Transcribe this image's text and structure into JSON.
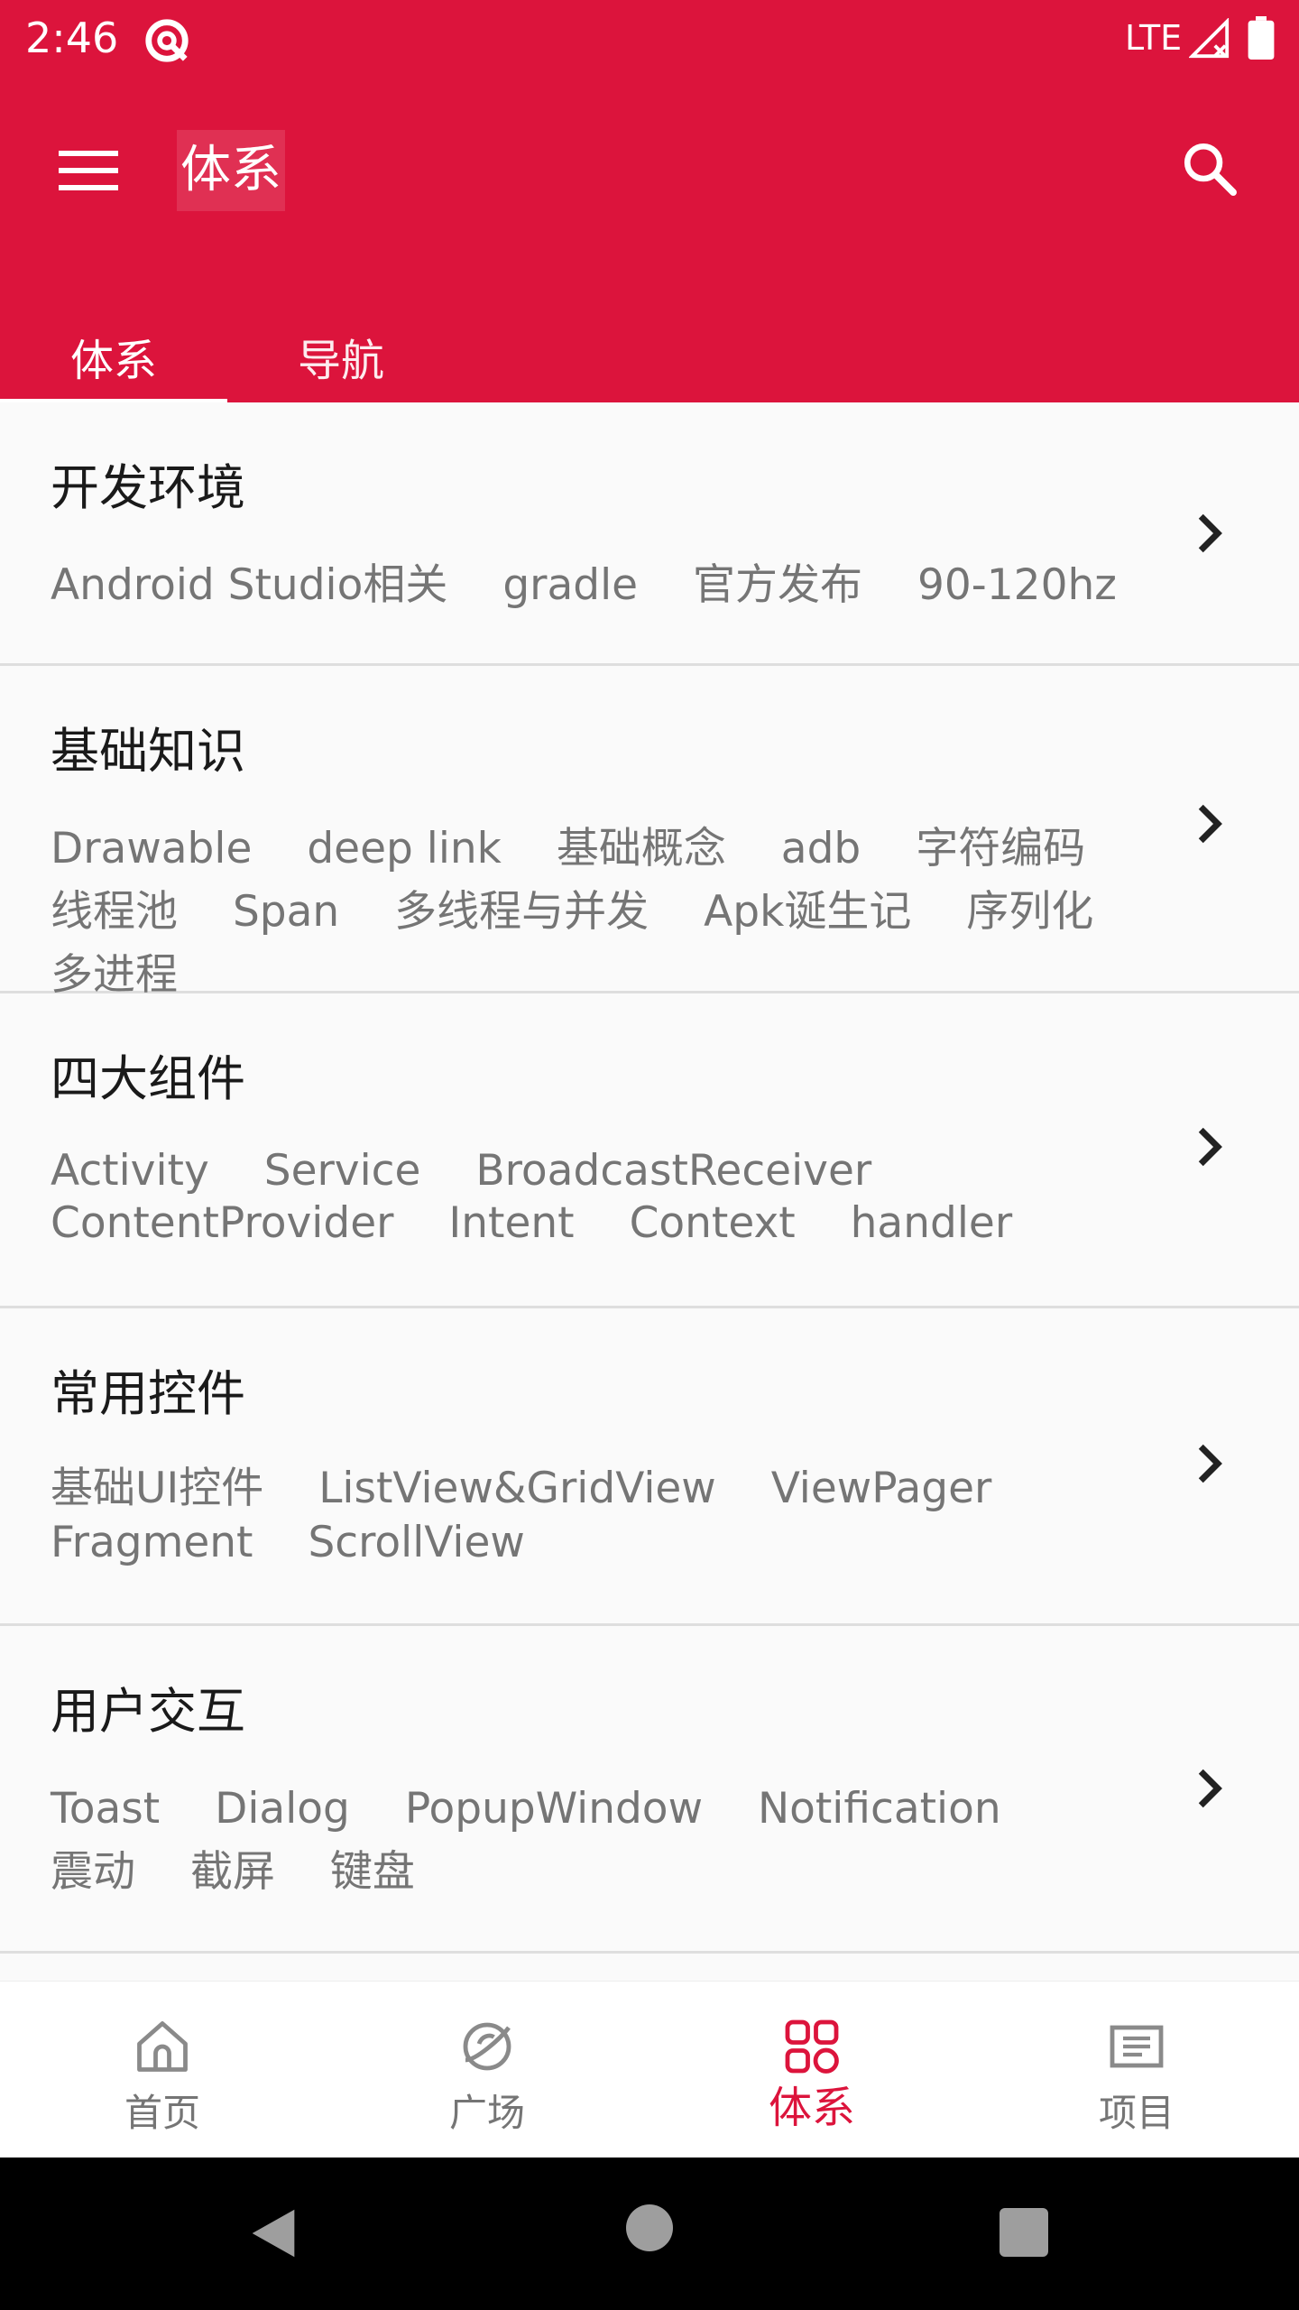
{
  "status_bar": {
    "time": "2:46",
    "network": "LTE",
    "icons": [
      "hotspot-icon",
      "signal-icon",
      "battery-icon"
    ]
  },
  "app_bar": {
    "title": "体系",
    "menu_icon": "menu-icon",
    "search_icon": "search-icon",
    "background_color": "#dc143c"
  },
  "tabs": [
    {
      "label": "体系",
      "selected": true
    },
    {
      "label": "导航",
      "selected": false
    }
  ],
  "categories": [
    {
      "title": "开发环境",
      "tags": [
        "Android Studio相关",
        "gradle",
        "官方发布",
        "90-120hz"
      ]
    },
    {
      "title": "基础知识",
      "tags": [
        "Drawable",
        "deep link",
        "基础概念",
        "adb",
        "字符编码",
        "线程池",
        "Span",
        "多线程与并发",
        "Apk诞生记",
        "序列化",
        "多进程"
      ]
    },
    {
      "title": "四大组件",
      "tags": [
        "Activity",
        "Service",
        "BroadcastReceiver",
        "ContentProvider",
        "Intent",
        "Context",
        "handler"
      ]
    },
    {
      "title": "常用控件",
      "tags": [
        "基础UI控件",
        "ListView&GridView",
        "ViewPager",
        "Fragment",
        "ScrollView"
      ]
    },
    {
      "title": "用户交互",
      "tags": [
        "Toast",
        "Dialog",
        "PopupWindow",
        "Notification",
        "震动",
        "截屏",
        "键盘"
      ]
    }
  ],
  "bottom_nav": [
    {
      "label": "首页",
      "icon": "home-icon",
      "active": false
    },
    {
      "label": "广场",
      "icon": "planet-icon",
      "active": false
    },
    {
      "label": "体系",
      "icon": "grid-icon",
      "active": true
    },
    {
      "label": "项目",
      "icon": "list-icon",
      "active": false
    }
  ],
  "colors": {
    "accent": "#dc143c",
    "inactive": "#757575"
  }
}
